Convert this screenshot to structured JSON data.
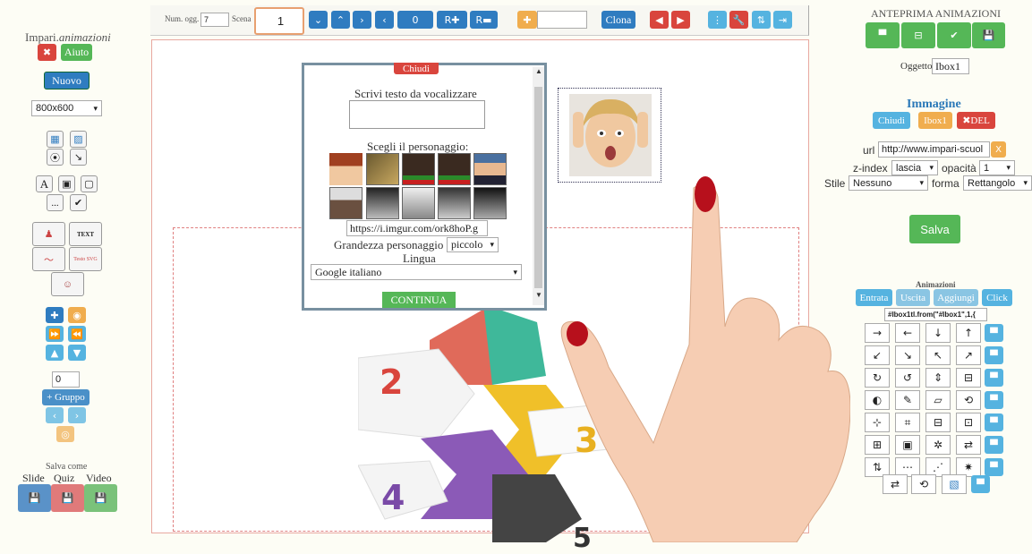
{
  "toolbar": {
    "num_label": "Num. ogg.",
    "num_value": "7",
    "scene_label": "Scena",
    "scene_value": "1",
    "counter": "0",
    "r_plus": "R✚",
    "r_minus": "R▬",
    "clone": "Clona"
  },
  "left": {
    "brand_main": "Impari.",
    "brand_italic": "animazioni",
    "help": "Aiuto",
    "new": "Nuovo",
    "resolution": "800x600",
    "text_tool": "A",
    "text_btn": "TEXT",
    "text_svg": "Testo SVG",
    "dots": "...",
    "group_input": "0",
    "group_btn": "+ Gruppo",
    "save_as": "Salva come",
    "save_opts": [
      "Slide",
      "Quiz",
      "Video"
    ]
  },
  "dialog": {
    "close": "Chiudi",
    "speak_label": "Scrivi testo da vocalizzare",
    "char_label": "Scegli il personaggio:",
    "url_value": "https://i.imgur.com/ork8hoP.g",
    "size_label": "Grandezza personaggio",
    "size_value": "piccolo",
    "lang_label": "Lingua",
    "lang_value": "Google italiano",
    "continue": "CONTINUA"
  },
  "right": {
    "preview_title": "ANTEPRIMA ANIMAZIONI",
    "object_label": "Oggetto",
    "object_value": "Ibox1",
    "image_title": "Immagine",
    "close": "Chiudi",
    "ibox": "Ibox1",
    "del": "✖DEL",
    "url_label": "url",
    "url_value": "http://www.impari-scuol",
    "url_x": "X",
    "zindex_label": "z-index",
    "zindex_value": "lascia",
    "opacity_label": "opacità",
    "opacity_value": "1",
    "style_label": "Stile",
    "style_value": "Nessuno",
    "shape_label": "forma",
    "shape_value": "Rettangolo",
    "save": "Salva",
    "anim_title": "Animazioni",
    "anim_tabs": [
      "Entrata",
      "Uscita",
      "Aggiungi",
      "Click"
    ],
    "anim_code": "#Ibox1tl.from(\"#Ibox1\",1,{",
    "grid": [
      [
        "→",
        "←",
        "↓",
        "↑"
      ],
      [
        "↙",
        "↘",
        "↖",
        "↗"
      ],
      [
        "↻",
        "↺",
        "⇕",
        "⊟"
      ],
      [
        "◐",
        "✎",
        "▱",
        "⟲"
      ],
      [
        "⊹",
        "⌗",
        "⊟",
        "⊡"
      ],
      [
        "⊞",
        "▣",
        "✲",
        "⇄"
      ],
      [
        "⇅",
        "⋯",
        "⋰",
        "✷"
      ]
    ],
    "last_row": [
      "⇄",
      "⟲"
    ]
  },
  "canvas": {
    "n2": "2",
    "n3": "3",
    "n4": "4",
    "n5": "5"
  },
  "colors": {
    "accent_blue": "#2f7cc0",
    "light_blue": "#55b3e0",
    "red": "#d9453d",
    "green": "#55b757",
    "orange": "#f0ad4e"
  }
}
